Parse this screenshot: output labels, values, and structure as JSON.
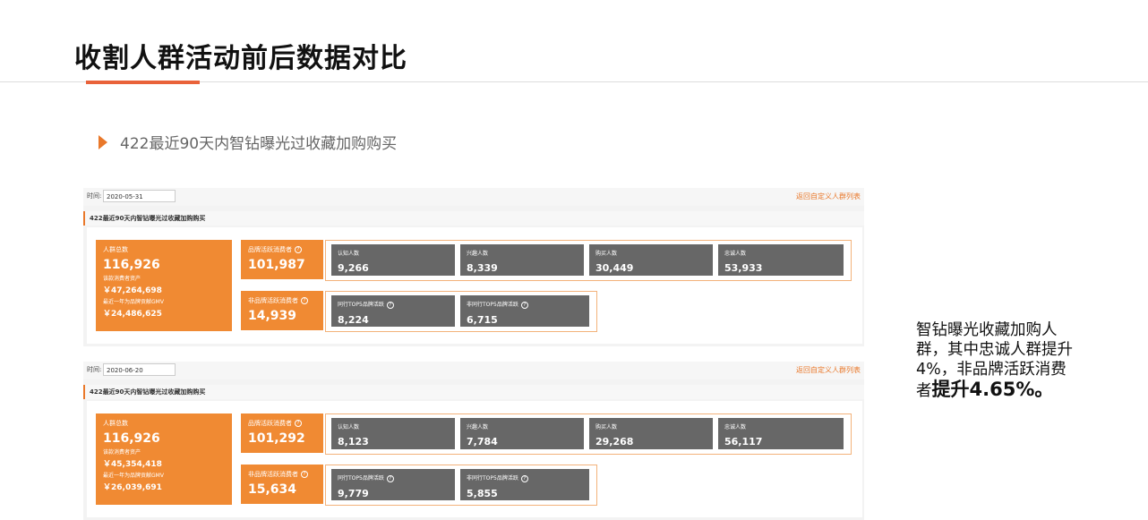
{
  "slide": {
    "title": "收割人群活动前后数据对比",
    "section_title": "422最近90天内智钻曝光过收藏加购购买",
    "note_prefix": "智钻曝光收藏加购人群，其中忠诚人群提升4%，非品牌活跃消费者",
    "note_emphasis": "提升4.65%。"
  },
  "panels": [
    {
      "time_label": "时间:",
      "date": "2020-05-31",
      "back_link": "返回自定义人群列表",
      "header": "422最近90天内智钻曝光过收藏加购购买",
      "pop_label": "人群总数",
      "pop_value": "116,926",
      "asset_label": "该款消费者资产",
      "asset_value": "￥47,264,698",
      "gmv_label": "最近一年为品牌贡献GMV",
      "gmv_value": "￥24,486,625",
      "brand_label": "品牌活跃消费者",
      "brand_value": "101,987",
      "nonbrand_label": "非品牌活跃消费者",
      "nonbrand_value": "14,939",
      "stages": [
        {
          "label": "认知人数",
          "value": "9,266"
        },
        {
          "label": "兴趣人数",
          "value": "8,339"
        },
        {
          "label": "购买人数",
          "value": "30,449"
        },
        {
          "label": "忠诚人数",
          "value": "53,933"
        }
      ],
      "tops": [
        {
          "label": "同行TOP5品牌活跃",
          "value": "8,224"
        },
        {
          "label": "非同行TOP5品牌活跃",
          "value": "6,715"
        }
      ]
    },
    {
      "time_label": "时间:",
      "date": "2020-06-20",
      "back_link": "返回自定义人群列表",
      "header": "422最近90天内智钻曝光过收藏加购购买",
      "pop_label": "人群总数",
      "pop_value": "116,926",
      "asset_label": "该款消费者资产",
      "asset_value": "￥45,354,418",
      "gmv_label": "最近一年为品牌贡献GMV",
      "gmv_value": "￥26,039,691",
      "brand_label": "品牌活跃消费者",
      "brand_value": "101,292",
      "nonbrand_label": "非品牌活跃消费者",
      "nonbrand_value": "15,634",
      "stages": [
        {
          "label": "认知人数",
          "value": "8,123"
        },
        {
          "label": "兴趣人数",
          "value": "7,784"
        },
        {
          "label": "购买人数",
          "value": "29,268"
        },
        {
          "label": "忠诚人数",
          "value": "56,117"
        }
      ],
      "tops": [
        {
          "label": "同行TOP5品牌活跃",
          "value": "9,779"
        },
        {
          "label": "非同行TOP5品牌活跃",
          "value": "5,855"
        }
      ]
    }
  ],
  "colors": {
    "accent": "#e9623a",
    "orange": "#f08a33",
    "gray_box": "#676767"
  }
}
